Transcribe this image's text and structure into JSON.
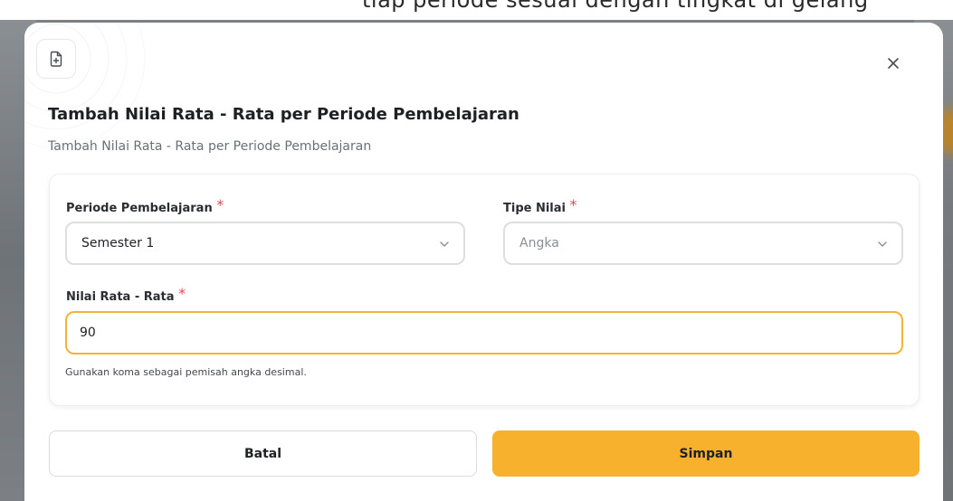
{
  "background": {
    "partial_heading": "tiap periode sesuai dengan tingkat di gelang"
  },
  "modal": {
    "title": "Tambah Nilai Rata - Rata per Periode Pembelajaran",
    "subtitle": "Tambah Nilai Rata - Rata per Periode Pembelajaran",
    "header_icon": "file-plus-icon",
    "close_icon": "close-icon",
    "fields": {
      "periode": {
        "label": "Periode Pembelajaran",
        "required_mark": "*",
        "value": "Semester 1"
      },
      "tipe": {
        "label": "Tipe Nilai",
        "required_mark": "*",
        "value": "Angka"
      },
      "nilai": {
        "label": "Nilai Rata - Rata",
        "required_mark": "*",
        "value": "90",
        "helper": "Gunakan koma sebagai pemisah angka desimal."
      }
    },
    "buttons": {
      "cancel": "Batal",
      "save": "Simpan"
    }
  },
  "colors": {
    "accent": "#F8B12C",
    "focus_border": "#F4B43A",
    "required": "#E5484D"
  }
}
